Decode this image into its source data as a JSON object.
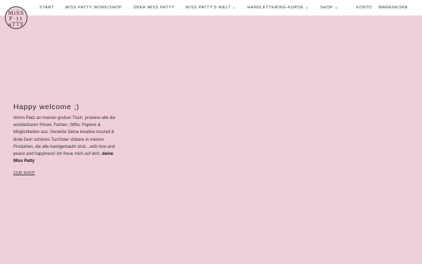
{
  "logo": {
    "line1": "MiSS",
    "line2": "P·tt",
    "line3": "aTTY"
  },
  "nav": {
    "items": [
      {
        "label": "START",
        "has_dropdown": false
      },
      {
        "label": "MISS PATTY WORK/SHOP",
        "has_dropdown": false
      },
      {
        "label": "ÜBER MISS PATTY",
        "has_dropdown": false
      },
      {
        "label": "MISS PATTY'S WELT",
        "has_dropdown": true
      },
      {
        "label": "HANDLETTERING-KURSE",
        "has_dropdown": true
      },
      {
        "label": "SHOP",
        "has_dropdown": true
      }
    ],
    "account_label": "KONTO",
    "cart_label": "WARENKORB"
  },
  "hero": {
    "title": "Happy welcome ;)",
    "body": "Nimm Platz an meinen großen Tisch, probiere alle die wunderbaren Pinsel, Farben, Stifte, Papiere & Möglichkeiten aus. Genieße Deine kreative Auszeit & finde Dein schönes Tun!Oder stöbere in meinen Produkten, die alle handgemacht sind....with love and peace and happiness! Ich freue mich auf dich,",
    "signature": "deine Miss Patty",
    "cta": "ZUM SHOP"
  },
  "colors": {
    "background": "#efd0da",
    "topbar": "#ffffff",
    "text": "#2a2a2a"
  }
}
